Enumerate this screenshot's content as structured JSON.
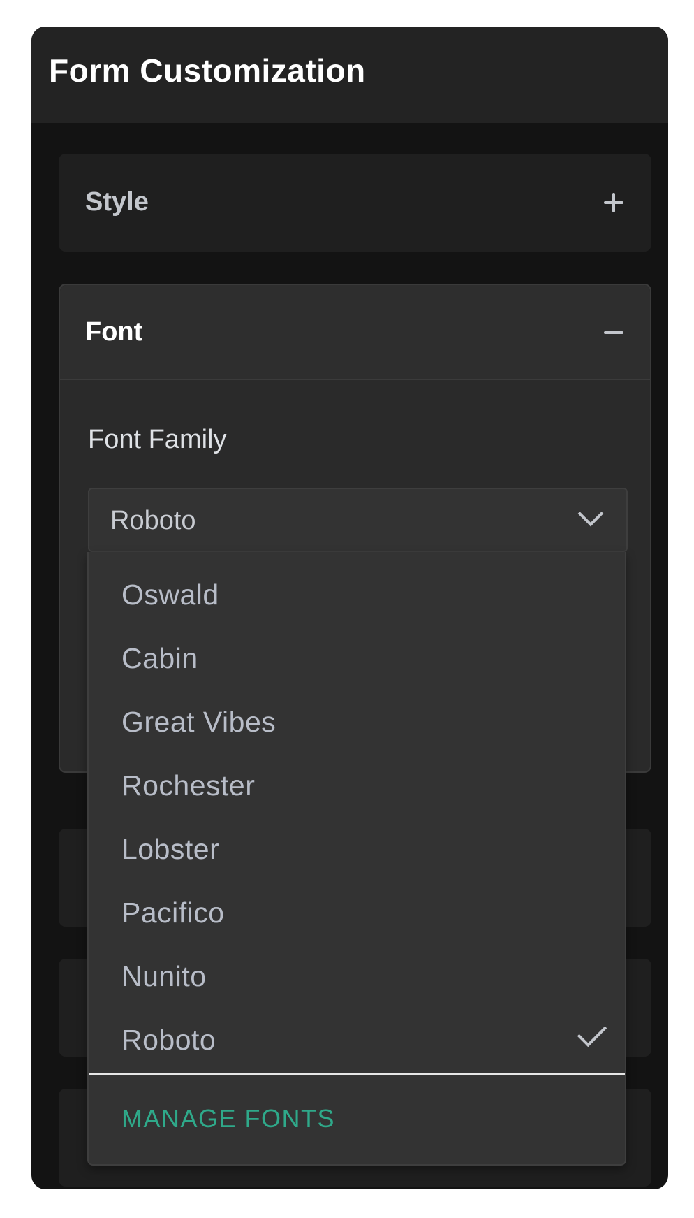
{
  "panel": {
    "title": "Form Customization"
  },
  "sections": {
    "style": {
      "label": "Style",
      "toggle_icon": "plus-icon"
    },
    "font": {
      "label": "Font",
      "toggle_icon": "minus-icon",
      "field_label": "Font Family",
      "selected_value": "Roboto"
    }
  },
  "dropdown": {
    "options": [
      "Oswald",
      "Cabin",
      "Great Vibes",
      "Rochester",
      "Lobster",
      "Pacifico",
      "Nunito",
      "Roboto"
    ],
    "selected": "Roboto",
    "manage_label": "MANAGE FONTS"
  },
  "colors": {
    "accent": "#2fa98a",
    "panel_bg": "#131313",
    "header_bg": "#232323"
  }
}
